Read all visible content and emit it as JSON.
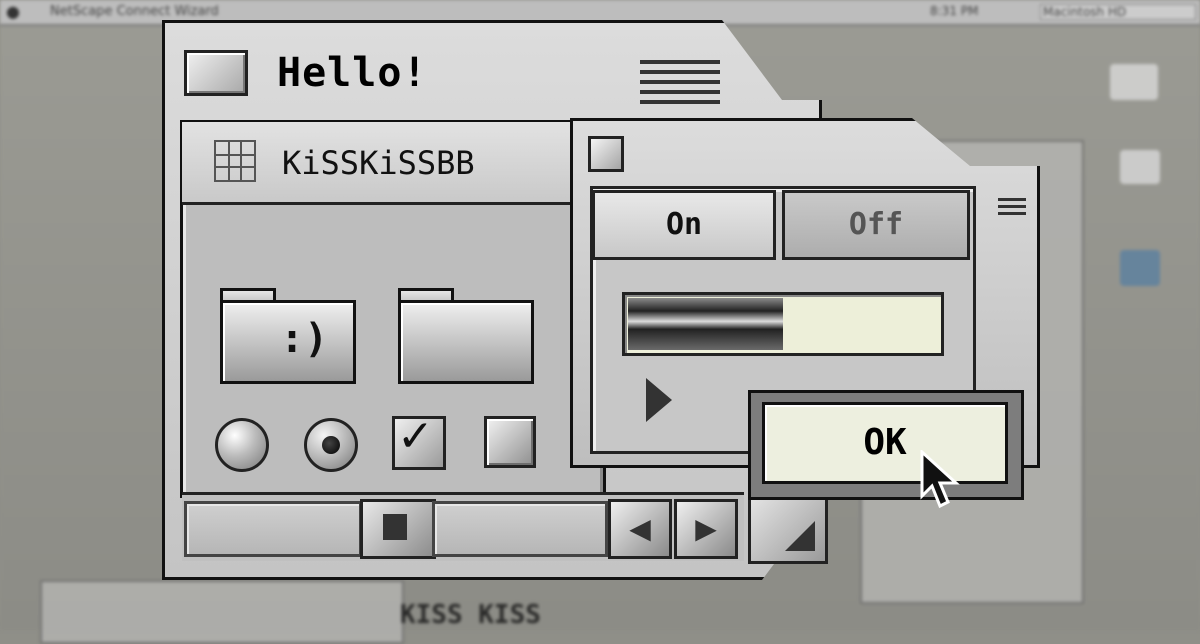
{
  "menubar": {
    "app_title": "NetScape Connect Wizard",
    "clock": "8:31 PM",
    "status": "Macintosh HD"
  },
  "background": {
    "kiss_text": "KISS KISS"
  },
  "main_window": {
    "title": "Hello!",
    "tab_label": "KiSSKiSSBB"
  },
  "toggle_window": {
    "on_label": "On",
    "off_label": "Off",
    "progress": 0.5
  },
  "dialog": {
    "ok_label": "OK"
  },
  "colors": {
    "progress_bg": "#edefd9",
    "ok_bg": "#edefdf",
    "window_border": "#111111"
  },
  "icons": {
    "close": "close-box-icon",
    "collapse": "collapse-lines-icon",
    "grid": "grid-icon",
    "finder": "finder-folder-icon",
    "folder": "folder-icon",
    "disclosure": "disclosure-triangle-icon",
    "cursor": "arrow-cursor-icon"
  }
}
